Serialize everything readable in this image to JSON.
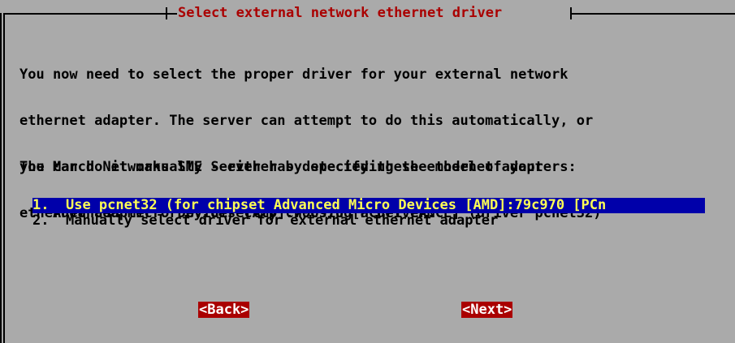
{
  "dialog": {
    "title": "Select external network ethernet driver",
    "intro_lines": [
      "You now need to select the proper driver for your external network",
      "ethernet adapter. The server can attempt to do this automatically, or",
      "you can do it manually - either by specifying the model of your",
      "ethernet adapter or by directly choosing a driver."
    ],
    "detect_lines": [
      "The March Networks SME Server has detected these ethernet adapters:",
      "    Advanced Micro Devices [AMD]:79c970 [PCnet LANCE] (driver pcnet32)"
    ],
    "menu": {
      "selected_index": 0,
      "items": [
        {
          "number": "1.",
          "label": "Use pcnet32 (for chipset Advanced Micro Devices [AMD]:79c970 [PCn"
        },
        {
          "number": "2.",
          "label": "Manually select driver for external ethernet adapter"
        }
      ]
    },
    "buttons": {
      "back": "<Back>",
      "next": "<Next>"
    }
  },
  "colors": {
    "background": "#aaaaaa",
    "title_text": "#aa0000",
    "selection_bg": "#0000aa",
    "selection_text": "#ffff55",
    "button_bg": "#aa0000",
    "button_text": "#ffffff"
  }
}
